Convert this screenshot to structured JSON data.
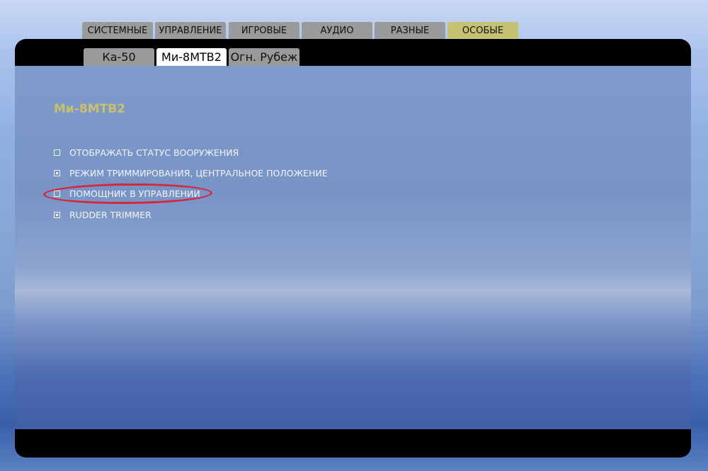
{
  "top_tabs": [
    {
      "label": "СИСТЕМНЫЕ",
      "active": false
    },
    {
      "label": "УПРАВЛЕНИЕ",
      "active": false
    },
    {
      "label": "ИГРОВЫЕ",
      "active": false
    },
    {
      "label": "АУДИО",
      "active": false
    },
    {
      "label": "РАЗНЫЕ",
      "active": false
    },
    {
      "label": "ОСОБЫЕ",
      "active": true
    }
  ],
  "sub_tabs": [
    {
      "label": "Ка-50",
      "active": false
    },
    {
      "label": "Ми-8МТВ2",
      "active": true
    },
    {
      "label": "Огн. Рубеж",
      "active": false
    }
  ],
  "section_title": "Ми-8МТВ2",
  "options": [
    {
      "label": "ОТОБРАЖАТЬ СТАТУС ВООРУЖЕНИЯ",
      "checked": false
    },
    {
      "label": "РЕЖИМ ТРИММИРОВАНИЯ, ЦЕНТРАЛЬНОЕ ПОЛОЖЕНИЕ",
      "checked": true
    },
    {
      "label": "ПОМОЩНИК В УПРАВЛЕНИИ",
      "checked": false
    },
    {
      "label": "RUDDER TRIMMER",
      "checked": true
    }
  ],
  "colors": {
    "active_top_tab": "#c6c274",
    "inactive_tab": "#999a9b",
    "section_title": "#c9c06a",
    "highlight": "#d6263a"
  }
}
